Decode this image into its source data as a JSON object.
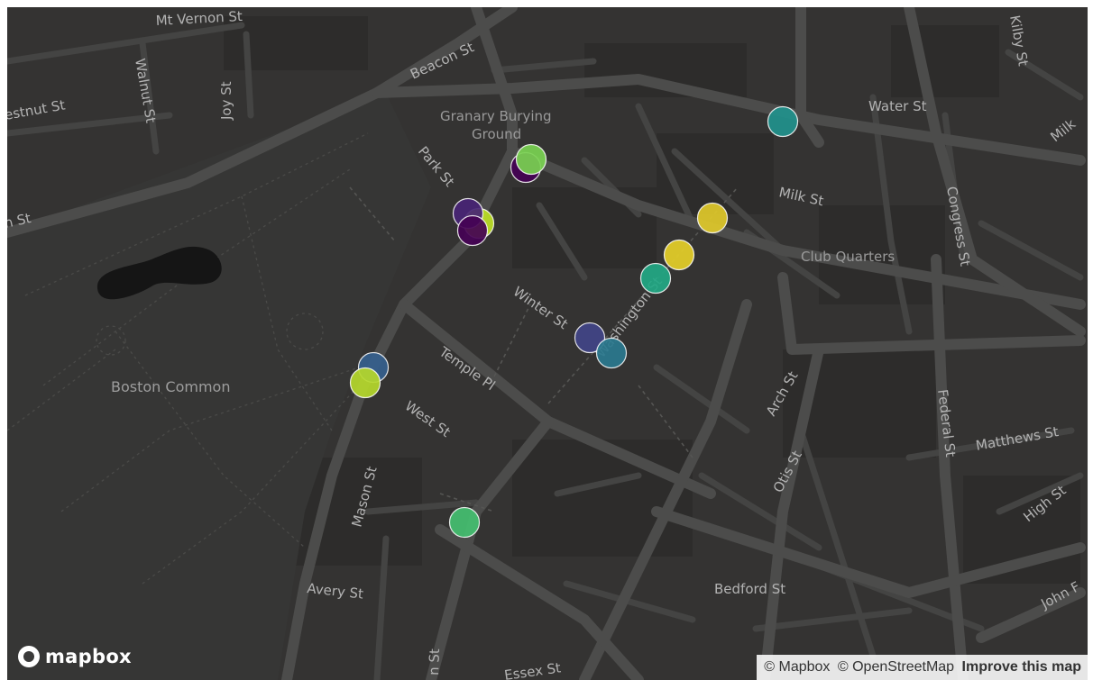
{
  "map": {
    "provider_logo": "mapbox",
    "attribution": {
      "mapbox": "© Mapbox",
      "osm": "© OpenStreetMap",
      "improve": "Improve this map"
    },
    "labels": {
      "mt_vernon": "Mt Vernon St",
      "beacon": "Beacon St",
      "chestnut": "estnut St",
      "walnut": "Walnut St",
      "joy": "Joy St",
      "granary_1": "Granary Burying",
      "granary_2": "Ground",
      "park": "Park St",
      "n_st": "n St",
      "water": "Water St",
      "milk": "Milk St",
      "milk_right": "Milk",
      "kilby": "Kilby St",
      "congress": "Congress St",
      "club_quarters": "Club Quarters",
      "winter": "Winter St",
      "washington": "Washington St",
      "temple": "Temple Pl",
      "west": "West St",
      "boston_common": "Boston Common",
      "arch": "Arch St",
      "otis": "Otis St",
      "federal": "Federal St",
      "matthews": "Matthews St",
      "high": "High St",
      "mason": "Mason St",
      "avery": "Avery St",
      "bedford": "Bedford St",
      "john_f": "John F",
      "bottom_st": "n St",
      "essex": "Essex St"
    },
    "markers": [
      {
        "id": "m1",
        "color": "#21918c"
      },
      {
        "id": "m2",
        "color": "#440154"
      },
      {
        "id": "m3",
        "color": "#7ad151"
      },
      {
        "id": "m4",
        "color": "#bddf26"
      },
      {
        "id": "m5",
        "color": "#482475"
      },
      {
        "id": "m6",
        "color": "#440154"
      },
      {
        "id": "m7",
        "color": "#dfc92a"
      },
      {
        "id": "m8",
        "color": "#e5cf28"
      },
      {
        "id": "m9",
        "color": "#22a884"
      },
      {
        "id": "m10",
        "color": "#414487"
      },
      {
        "id": "m11",
        "color": "#2a788e"
      },
      {
        "id": "m12",
        "color": "#355f8d"
      },
      {
        "id": "m13",
        "color": "#b5d82b"
      },
      {
        "id": "m14",
        "color": "#44bf70"
      }
    ]
  }
}
